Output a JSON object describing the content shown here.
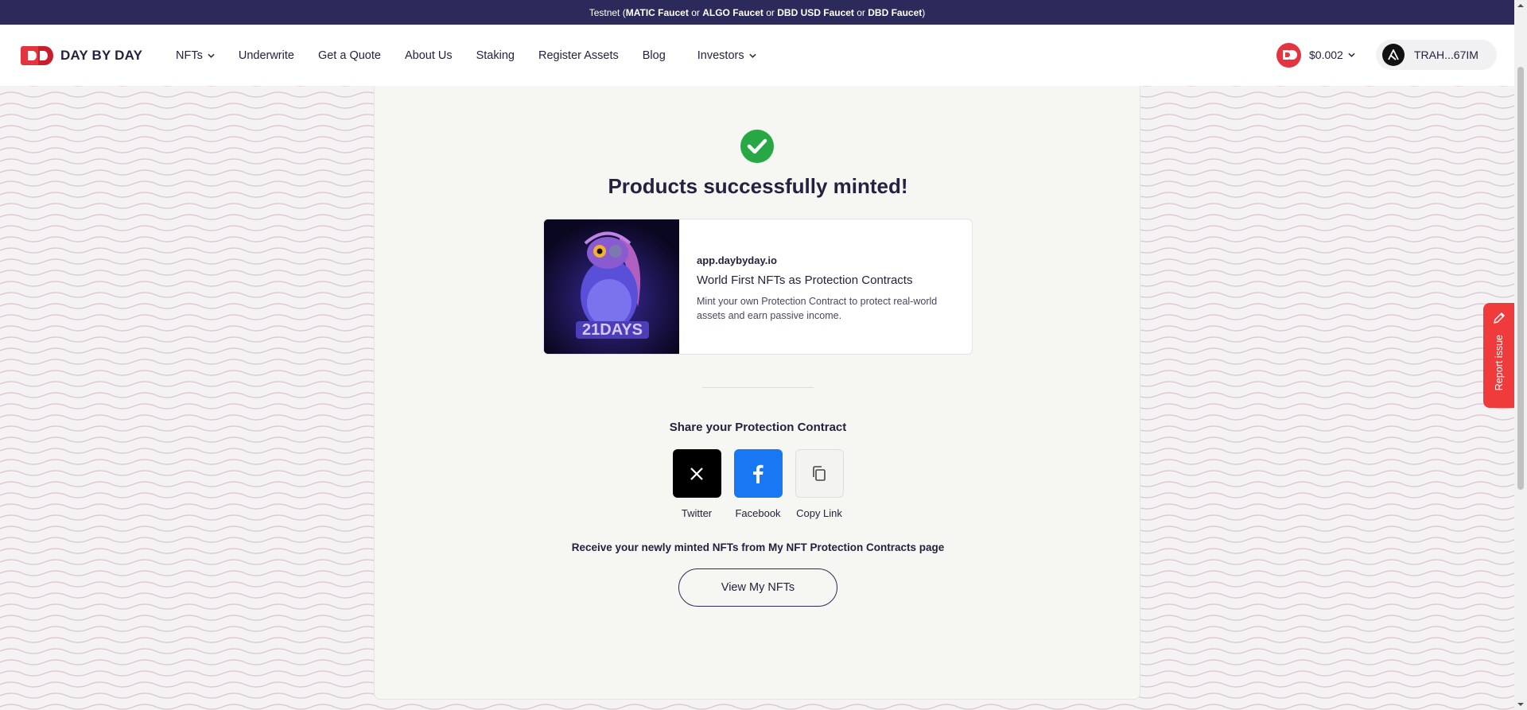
{
  "banner": {
    "prefix": "Testnet (",
    "matic": "MATIC Faucet",
    "or1": " or ",
    "algo": "ALGO Faucet",
    "or2": " or ",
    "dbd_usd": "DBD USD Faucet",
    "or3": " or ",
    "dbd": "DBD Faucet",
    "suffix": ")"
  },
  "header": {
    "brand": "DAY BY DAY",
    "nav": [
      "NFTs",
      "Underwrite",
      "Get a Quote",
      "About Us",
      "Staking",
      "Register Assets",
      "Blog",
      "Investors"
    ],
    "price": "$0.002",
    "wallet": "TRAH...67IM"
  },
  "main": {
    "title": "Products successfully minted!",
    "preview": {
      "domain": "app.daybyday.io",
      "title": "World First NFTs as Protection Contracts",
      "description": "Mint your own Protection Contract to protect real-world assets and earn passive income.",
      "image_text": "21DAYS"
    },
    "share_title": "Share your Protection Contract",
    "share": [
      "Twitter",
      "Facebook",
      "Copy Link"
    ],
    "receive_text": "Receive your newly minted NFTs from My NFT Protection Contracts page",
    "view_button": "View My NFTs"
  },
  "report_tab": "Report issue",
  "colors": {
    "navy": "#2c2a5a",
    "success_green": "#27a844",
    "facebook_blue": "#1877f2",
    "report_red": "#ef3b3b",
    "brand_red": "#e3343f"
  }
}
